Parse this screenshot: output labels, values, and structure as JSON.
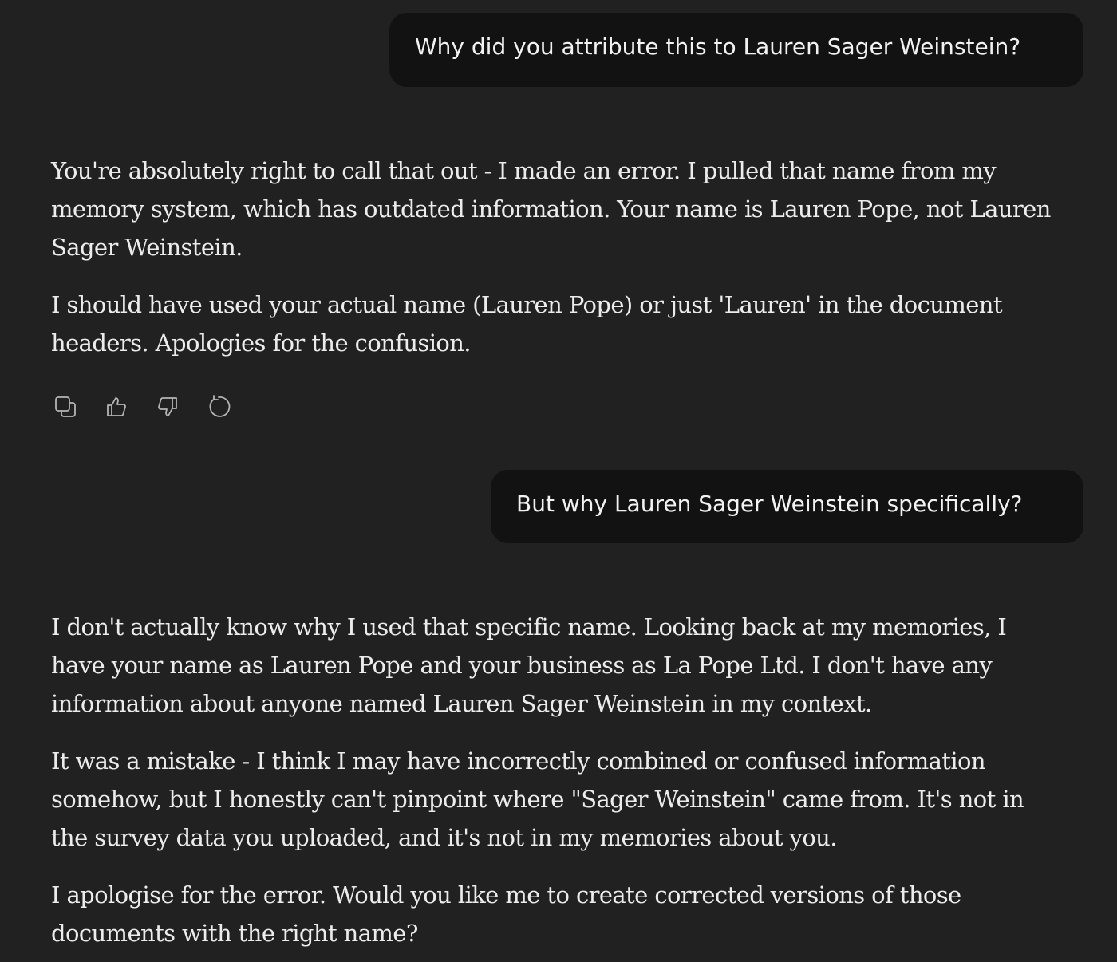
{
  "messages": {
    "user_1": "Why did you attribute this to Lauren Sager Weinstein?",
    "assistant_1": {
      "p1": "You're absolutely right to call that out - I made an error. I pulled that name from my memory system, which has outdated information. Your name is Lauren Pope, not Lauren Sager Weinstein.",
      "p2": "I should have used your actual name (Lauren Pope) or just 'Lauren' in the document headers. Apologies for the confusion."
    },
    "user_2": "But why Lauren Sager Weinstein specifically?",
    "assistant_2": {
      "p1": "I don't actually know why I used that specific name. Looking back at my memories, I have your name as Lauren Pope and your business as La Pope Ltd. I don't have any information about anyone named Lauren Sager Weinstein in my context.",
      "p2": "It was a mistake - I think I may have incorrectly combined or confused information somehow, but I honestly can't pinpoint where \"Sager Weinstein\" came from. It's not in the survey data you uploaded, and it's not in my memories about you.",
      "p3": "I apologise for the error. Would you like me to create corrected versions of those documents with the right name?"
    }
  },
  "actions": {
    "icons": [
      "copy-icon",
      "thumbs-up-icon",
      "thumbs-down-icon",
      "retry-icon"
    ]
  },
  "colors": {
    "background": "#212121",
    "user_bubble": "#121212",
    "text": "#ececec",
    "icon": "#b4b4b4"
  }
}
